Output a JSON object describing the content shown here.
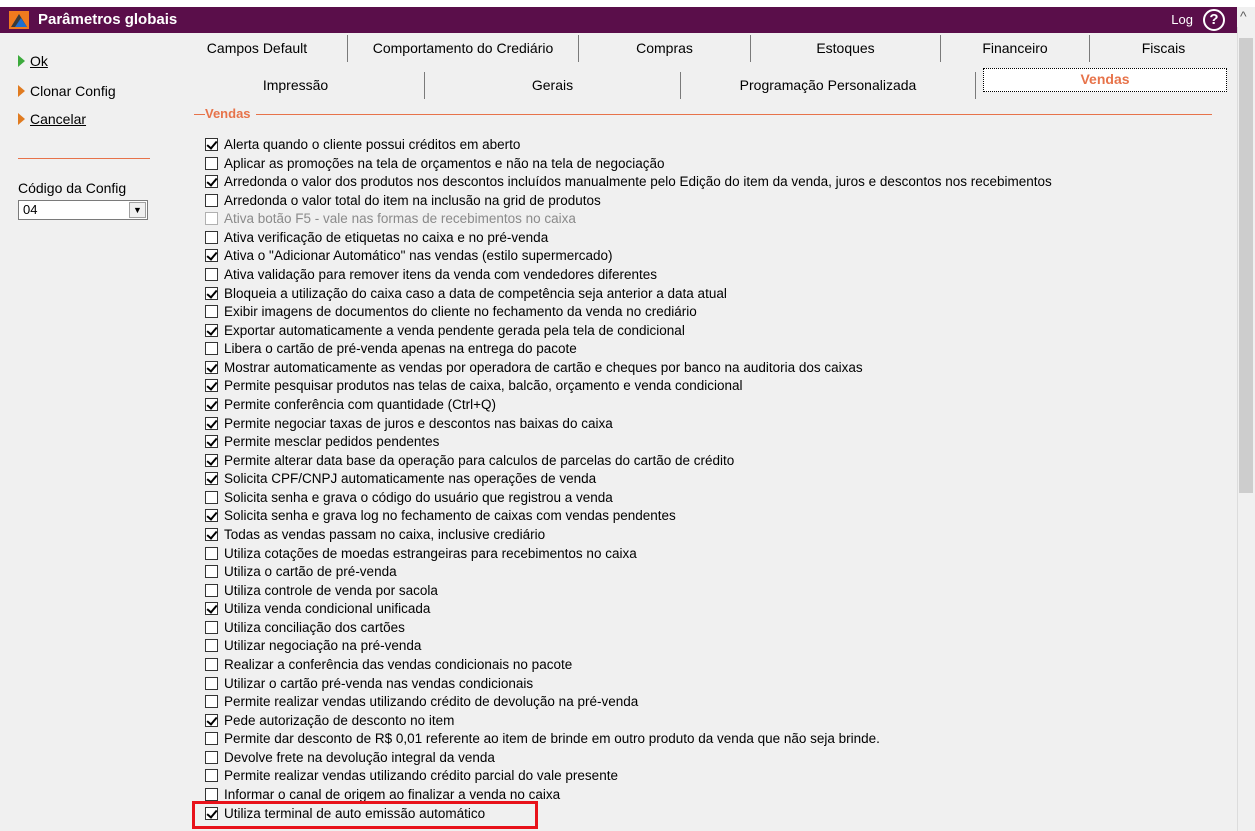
{
  "window": {
    "title": "Parâmetros globais",
    "log_label": "Log",
    "help_label": "?"
  },
  "sidebar": {
    "actions": [
      {
        "label": "Ok",
        "color": "green"
      },
      {
        "label": "Clonar Config",
        "color": "orange"
      },
      {
        "label": "Cancelar",
        "color": "orange"
      }
    ],
    "config_code_label": "Código da Config",
    "config_code_value": "04"
  },
  "tabs": {
    "row1": [
      "Campos Default",
      "Comportamento do Crediário",
      "Compras",
      "Estoques",
      "Financeiro",
      "Fiscais"
    ],
    "row2": [
      "Impressão",
      "Gerais",
      "Programação Personalizada",
      "Vendas"
    ],
    "active": "Vendas"
  },
  "group": {
    "title": "Vendas",
    "options": [
      {
        "label": "Alerta quando o cliente possui créditos em aberto",
        "checked": true
      },
      {
        "label": "Aplicar as promoções na tela de orçamentos e não na tela de negociação",
        "checked": false
      },
      {
        "label": "Arredonda o valor dos produtos nos descontos incluídos manualmente pelo Edição do item da venda, juros e descontos nos recebimentos",
        "checked": true
      },
      {
        "label": "Arredonda o valor total do item na inclusão na grid de produtos",
        "checked": false
      },
      {
        "label": "Ativa botão F5 - vale nas formas de recebimentos no caixa",
        "checked": false,
        "disabled": true
      },
      {
        "label": "Ativa verificação de etiquetas no caixa e no pré-venda",
        "checked": false
      },
      {
        "label": "Ativa o \"Adicionar Automático\"  nas vendas (estilo supermercado)",
        "checked": true
      },
      {
        "label": "Ativa validação para remover itens da venda com vendedores diferentes",
        "checked": false
      },
      {
        "label": "Bloqueia a utilização do caixa caso a data de competência seja anterior a data atual",
        "checked": true
      },
      {
        "label": "Exibir imagens de documentos do cliente no fechamento da venda no crediário",
        "checked": false
      },
      {
        "label": "Exportar automaticamente a venda pendente gerada pela tela de condicional",
        "checked": true
      },
      {
        "label": "Libera o cartão de pré-venda apenas na entrega do pacote",
        "checked": false
      },
      {
        "label": "Mostrar automaticamente as vendas por operadora de cartão e cheques por banco na auditoria dos caixas",
        "checked": true
      },
      {
        "label": "Permite pesquisar produtos nas telas de caixa, balcão, orçamento e venda condicional",
        "checked": true
      },
      {
        "label": "Permite conferência com quantidade (Ctrl+Q)",
        "checked": true
      },
      {
        "label": "Permite negociar taxas de juros e descontos nas baixas do caixa",
        "checked": true
      },
      {
        "label": "Permite mesclar pedidos pendentes",
        "checked": true
      },
      {
        "label": "Permite alterar data base da operação para calculos de parcelas do cartão de crédito",
        "checked": true
      },
      {
        "label": "Solicita CPF/CNPJ automaticamente nas operações de venda",
        "checked": true
      },
      {
        "label": "Solicita senha e grava o código do usuário que registrou a venda",
        "checked": false
      },
      {
        "label": "Solicita senha e grava log no fechamento de caixas com vendas pendentes",
        "checked": true
      },
      {
        "label": "Todas as vendas passam no caixa, inclusive crediário",
        "checked": true
      },
      {
        "label": "Utiliza cotações de moedas estrangeiras para recebimentos no caixa",
        "checked": false
      },
      {
        "label": "Utiliza o cartão de pré-venda",
        "checked": false
      },
      {
        "label": "Utiliza controle de venda por sacola",
        "checked": false
      },
      {
        "label": "Utiliza venda condicional unificada",
        "checked": true
      },
      {
        "label": "Utiliza conciliação dos cartões",
        "checked": false
      },
      {
        "label": "Utilizar negociação na pré-venda",
        "checked": false
      },
      {
        "label": "Realizar a conferência das vendas condicionais no pacote",
        "checked": false
      },
      {
        "label": "Utilizar o cartão pré-venda nas vendas condicionais",
        "checked": false
      },
      {
        "label": "Permite realizar vendas utilizando crédito de devolução na pré-venda",
        "checked": false
      },
      {
        "label": "Pede autorização de desconto no item",
        "checked": true
      },
      {
        "label": "Permite dar desconto de R$ 0,01 referente ao item de brinde em outro produto da venda que não seja brinde.",
        "checked": false
      },
      {
        "label": "Devolve frete na devolução integral da venda",
        "checked": false
      },
      {
        "label": "Permite realizar vendas utilizando crédito parcial do vale presente",
        "checked": false
      },
      {
        "label": "Informar o canal de origem ao finalizar a venda no caixa",
        "checked": false
      },
      {
        "label": "Utiliza terminal de auto emissão automático",
        "checked": true
      }
    ]
  },
  "colors": {
    "titlebar": "#5a0e4a",
    "accent": "#e7734a",
    "highlight": "#e8111a"
  }
}
